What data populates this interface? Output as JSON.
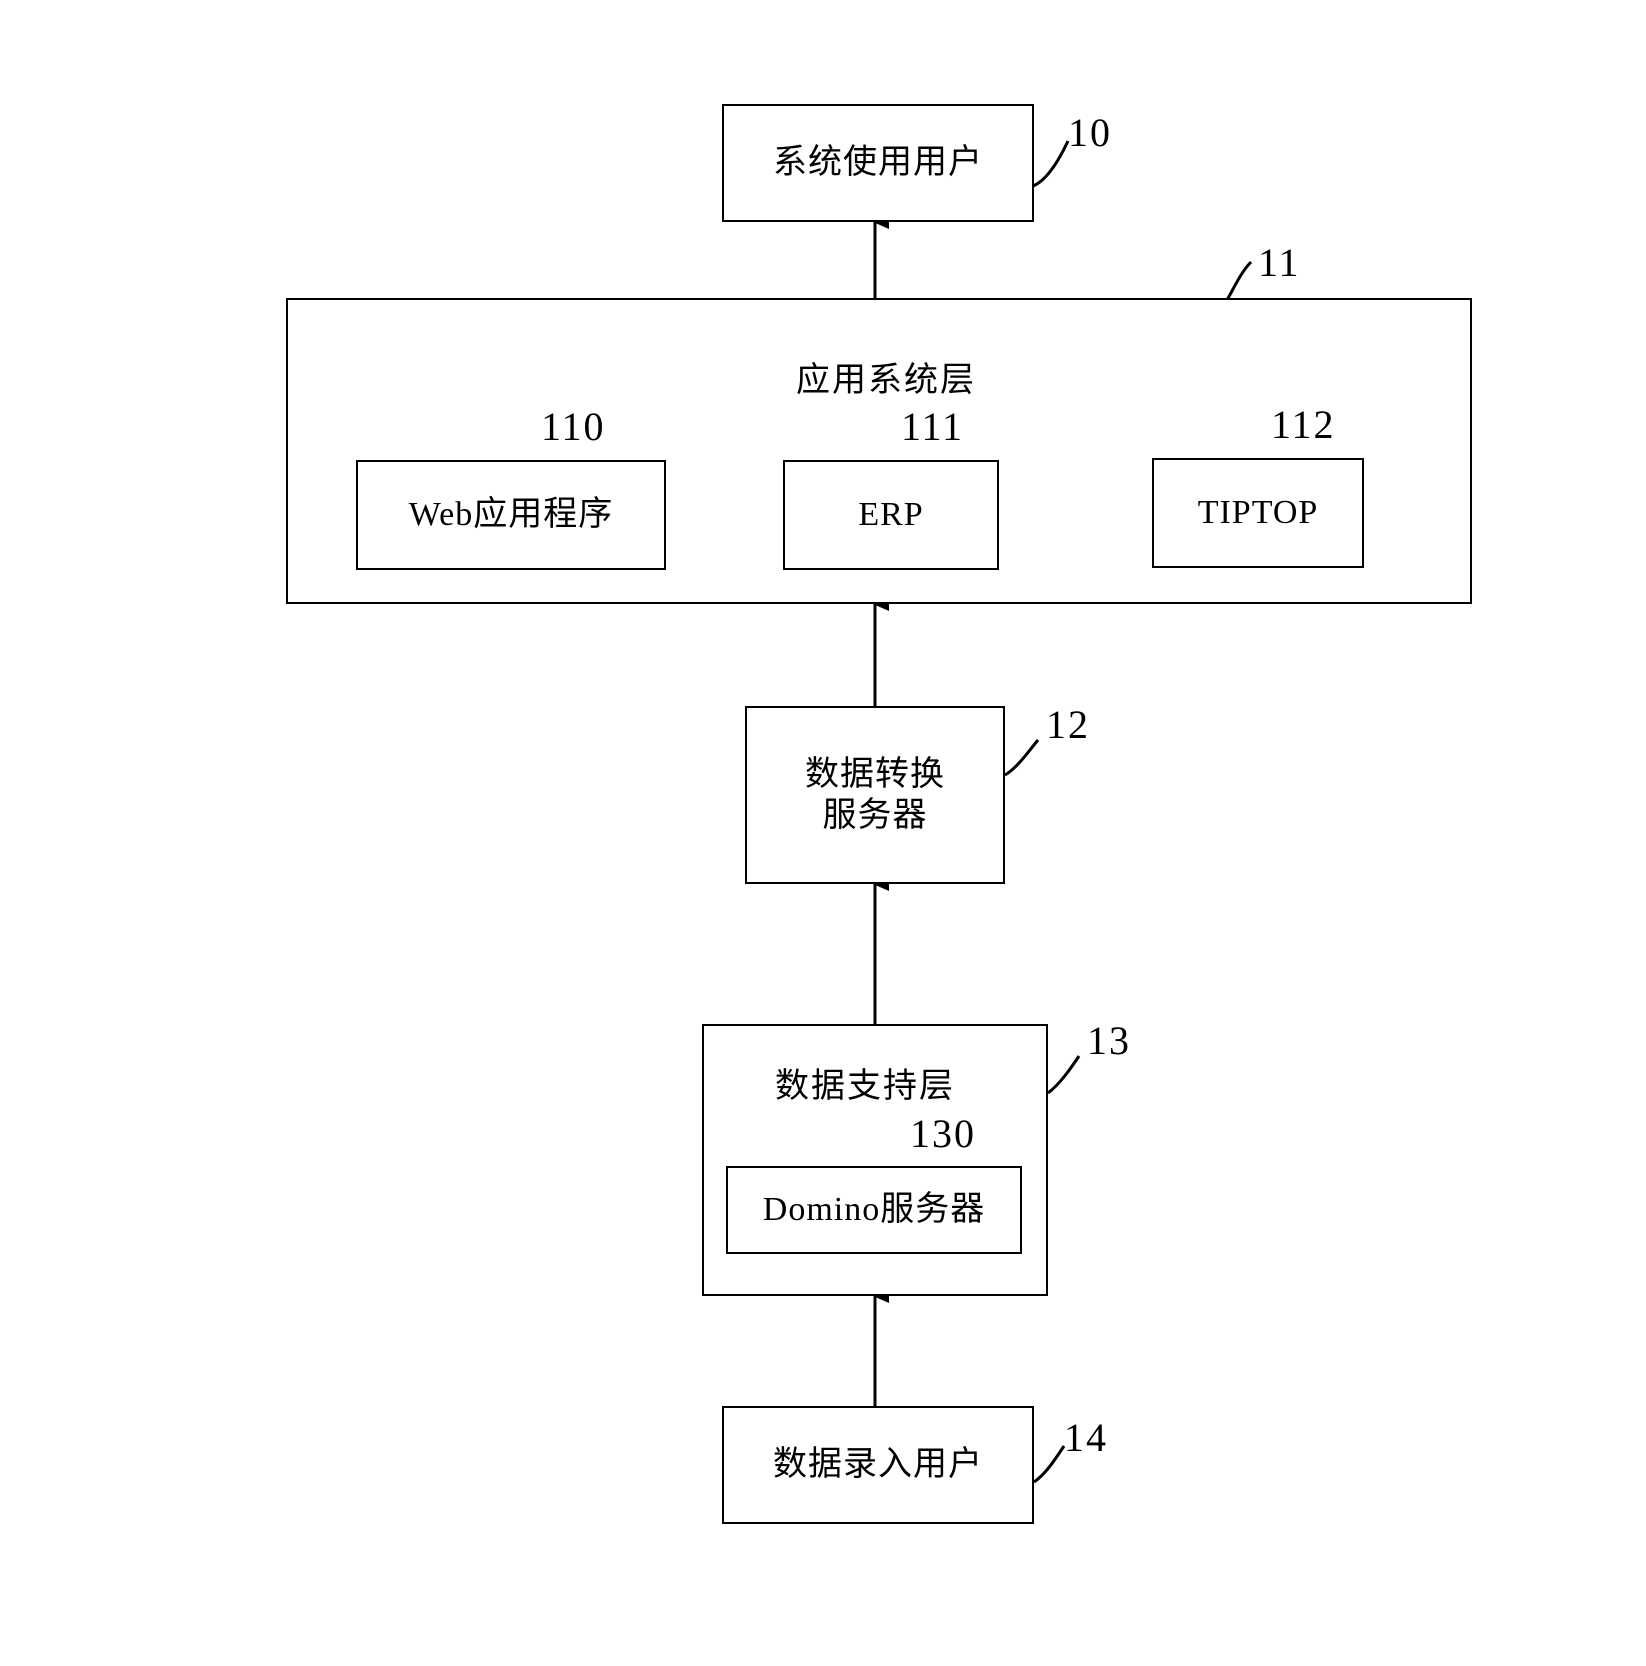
{
  "figure": {
    "kind": "patent-block-diagram",
    "background_color": "#ffffff",
    "line_color": "#000000"
  },
  "nodes": {
    "system_user": {
      "label": "系统使用用户",
      "ref": "10"
    },
    "application_layer": {
      "label": "应用系统层",
      "ref": "11"
    },
    "web_application": {
      "label": "Web应用程序",
      "ref": "110"
    },
    "erp": {
      "label": "ERP",
      "ref": "111"
    },
    "tiptop": {
      "label": "TIPTOP",
      "ref": "112"
    },
    "data_conversion_server": {
      "label": "数据转换\n服务器",
      "ref": "12"
    },
    "data_support_layer": {
      "label": "数据支持层",
      "ref": "13"
    },
    "domino_server": {
      "label": "Domino服务器",
      "ref": "130"
    },
    "data_entry_user": {
      "label": "数据录入用户",
      "ref": "14"
    }
  },
  "connections": [
    {
      "from": "application_layer",
      "to": "system_user",
      "style": "solid",
      "arrow": "up"
    },
    {
      "from": "data_conversion_server",
      "to": "application_layer",
      "style": "solid",
      "arrow": "up"
    },
    {
      "from": "data_support_layer",
      "to": "data_conversion_server",
      "style": "solid",
      "arrow": "up"
    },
    {
      "from": "data_entry_user",
      "to": "data_support_layer",
      "style": "solid",
      "arrow": "up"
    }
  ]
}
